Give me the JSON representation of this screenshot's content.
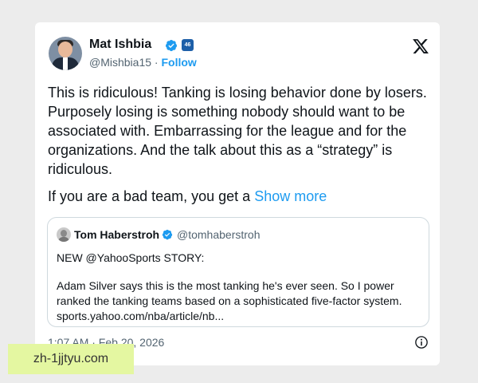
{
  "post": {
    "author": {
      "name": "Mat Ishbia",
      "handle": "@Mishbia15",
      "separator": "·",
      "follow_label": "Follow",
      "affiliate_badge": "46"
    },
    "body": "This is ridiculous! Tanking is losing behavior done by losers. Purposely losing is something nobody should want to be associated with. Embarrassing for the league and for the organizations. And the talk about this as a “strategy” is ridiculous.",
    "continued": "If you are a bad team, you get a",
    "show_more_label": "Show more",
    "timestamp": "1:07 AM · Feb 20, 2026",
    "quote": {
      "name": "Tom Haberstroh",
      "handle": "@tomhaberstroh",
      "line1": "NEW @YahooSports STORY:",
      "body": "Adam Silver says this is the most tanking he's ever seen. So I power ranked the tanking teams based on a sophisticated five-factor system. sports.yahoo.com/nba/article/nb..."
    }
  },
  "watermark": "zh-1jjtyu.com",
  "icons": {
    "platform_logo": "x-logo-icon",
    "verified": "verified-badge-icon",
    "info": "info-icon"
  },
  "colors": {
    "accent": "#1d9bf0",
    "text": "#0f1419",
    "secondary_text": "#536471",
    "quote_border": "#cfd9de"
  }
}
